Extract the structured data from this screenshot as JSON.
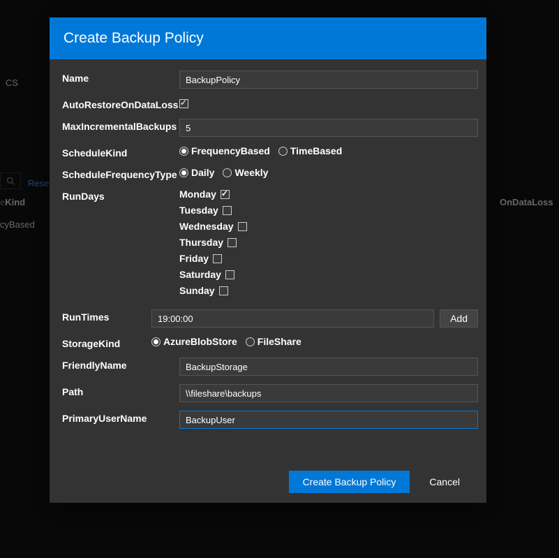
{
  "background": {
    "reset_label": "Reset",
    "col_kind": "Kind",
    "col_dataloss": "OnDataLoss",
    "row_cybased": "cyBased",
    "cs_label": "CS"
  },
  "modal": {
    "title": "Create Backup Policy",
    "labels": {
      "name": "Name",
      "autorestore": "AutoRestoreOnDataLoss",
      "maxinc": "MaxIncrementalBackups",
      "schedkind": "ScheduleKind",
      "schedfreq": "ScheduleFrequencyType",
      "rundays": "RunDays",
      "runtimes": "RunTimes",
      "storagekind": "StorageKind",
      "friendly": "FriendlyName",
      "path": "Path",
      "primaryuser": "PrimaryUserName"
    },
    "values": {
      "name": "BackupPolicy",
      "autorestore_checked": true,
      "maxinc": "5",
      "schedkind_options": [
        "FrequencyBased",
        "TimeBased"
      ],
      "schedkind_selected": "FrequencyBased",
      "schedfreq_options": [
        "Daily",
        "Weekly"
      ],
      "schedfreq_selected": "Daily",
      "days": [
        {
          "label": "Monday",
          "checked": true
        },
        {
          "label": "Tuesday",
          "checked": false
        },
        {
          "label": "Wednesday",
          "checked": false
        },
        {
          "label": "Thursday",
          "checked": false
        },
        {
          "label": "Friday",
          "checked": false
        },
        {
          "label": "Saturday",
          "checked": false
        },
        {
          "label": "Sunday",
          "checked": false
        }
      ],
      "runtime": "19:00:00",
      "add_label": "Add",
      "storagekind_options": [
        "AzureBlobStore",
        "FileShare"
      ],
      "storagekind_selected": "AzureBlobStore",
      "friendly": "BackupStorage",
      "path": "\\\\fileshare\\backups",
      "primaryuser": "BackupUser"
    },
    "buttons": {
      "create": "Create Backup Policy",
      "cancel": "Cancel"
    }
  }
}
